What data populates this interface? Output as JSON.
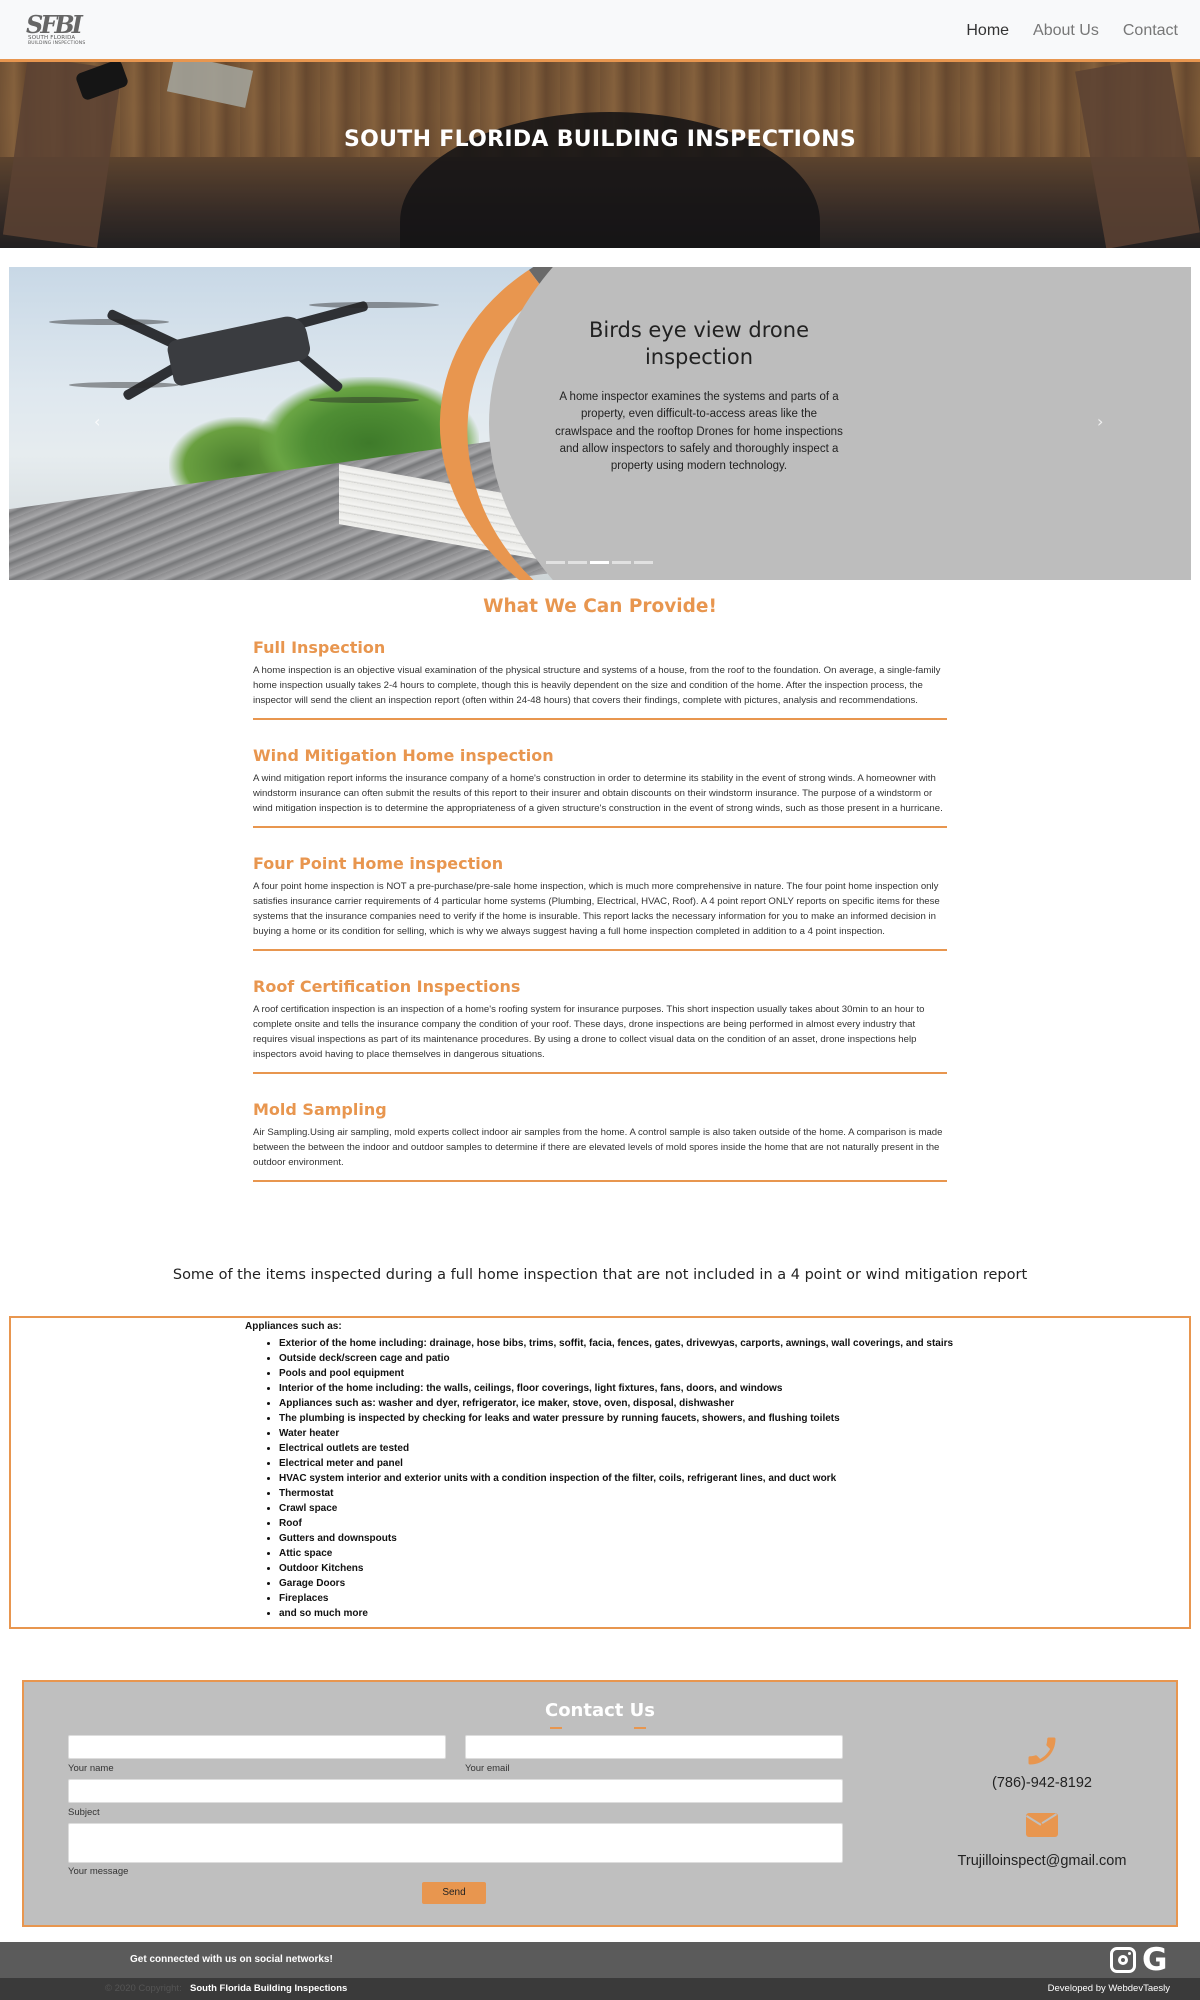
{
  "brand": {
    "logo_mark": "SFBI",
    "logo_line1": "SOUTH FLORIDA",
    "logo_line2": "BUILDING INSPECTIONS"
  },
  "nav": {
    "items": [
      {
        "label": "Home",
        "active": true
      },
      {
        "label": "About Us",
        "active": false
      },
      {
        "label": "Contact",
        "active": false
      }
    ]
  },
  "hero": {
    "title": "SOUTH FLORIDA BUILDING INSPECTIONS"
  },
  "carousel": {
    "title": "Birds eye view drone inspection",
    "text": "A home inspector examines the systems and parts of a property, even difficult-to-access areas like the crawlspace and the rooftop Drones for home inspections and allow inspectors to safely and thoroughly inspect a property using modern technology.",
    "prev_icon": "‹",
    "next_icon": "›",
    "slide_count": 5,
    "active_slide": 3
  },
  "services": {
    "title": "What We Can Provide!",
    "items": [
      {
        "title": "Full Inspection",
        "text": "A home inspection is an objective visual examination of the physical structure and systems of a house, from the roof to the foundation. On average, a single-family home inspection usually takes 2-4 hours to complete, though this is heavily dependent on the size and condition of the home. After the inspection process, the inspector will send the client an inspection report (often within 24-48 hours) that covers their findings, complete with pictures, analysis and recommendations."
      },
      {
        "title": "Wind Mitigation Home inspection",
        "text": "A wind mitigation report informs the insurance company of a home's construction in order to determine its stability in the event of strong winds. A homeowner with windstorm insurance can often submit the results of this report to their insurer and obtain discounts on their windstorm insurance. The purpose of a windstorm or wind mitigation inspection is to determine the appropriateness of a given structure's construction in the event of strong winds, such as those present in a hurricane."
      },
      {
        "title": "Four Point Home inspection",
        "text": "A four point home inspection is NOT a pre-purchase/pre-sale home inspection, which is much more comprehensive in nature. The four point home inspection only satisfies insurance carrier requirements of 4 particular home systems (Plumbing, Electrical, HVAC, Roof). A 4 point report ONLY reports on specific items for these systems that the insurance companies need to verify if the home is insurable. This report lacks the necessary information for you to make an informed decision in buying a home or its condition for selling, which is why we always suggest having a full home inspection completed in addition to a 4 point inspection."
      },
      {
        "title": "Roof Certification Inspections",
        "text": "A roof certification inspection is an inspection of a home's roofing system for insurance purposes. This short inspection usually takes about 30min to an hour to complete onsite and tells the insurance company the condition of your roof. These days, drone inspections are being performed in almost every industry that requires visual inspections as part of its maintenance procedures. By using a drone to collect visual data on the condition of an asset, drone inspections help inspectors avoid having to place themselves in dangerous situations."
      },
      {
        "title": "Mold Sampling",
        "text": "Air Sampling.Using air sampling, mold experts collect indoor air samples from the home. A control sample is also taken outside of the home. A comparison is made between the between the indoor and outdoor samples to determine if there are elevated levels of mold spores inside the home that are not naturally present in the outdoor environment."
      }
    ]
  },
  "inspected": {
    "heading": "Some of the items inspected during a full home inspection that are not included in a 4 point or wind mitigation report",
    "label": "Appliances such as:",
    "items": [
      "Exterior of the home including: drainage, hose bibs, trims, soffit, facia, fences, gates, drivewyas, carports, awnings, wall coverings, and stairs",
      "Outside deck/screen cage and patio",
      "Pools and pool equipment",
      "Interior of the home including: the walls, ceilings, floor coverings, light fixtures, fans, doors, and windows",
      "Appliances such as: washer and dyer, refrigerator, ice maker, stove, oven, disposal, dishwasher",
      "The plumbing is inspected by checking for leaks and water pressure by running faucets, showers, and flushing toilets",
      "Water heater",
      "Electrical outlets are tested",
      "Electrical meter and panel",
      "HVAC system interior and exterior units with a condition inspection of the filter, coils, refrigerant lines, and duct work",
      "Thermostat",
      "Crawl space",
      "Roof",
      "Gutters and downspouts",
      "Attic space",
      "Outdoor Kitchens",
      "Garage Doors",
      "Fireplaces",
      "and so much more"
    ]
  },
  "contact": {
    "title": "Contact Us",
    "name_label": "Your name",
    "email_label": "Your email",
    "subject_label": "Subject",
    "message_label": "Your message",
    "send_label": "Send",
    "phone": "(786)-942-8192",
    "email": "Trujilloinspect@gmail.com"
  },
  "footer": {
    "social_text": "Get connected with us on social networks!",
    "copyright_prefix": "© 2020 Copyright:",
    "copyright_name": "South Florida Building Inspections",
    "developer": "Developed by WebdevTaesly",
    "google_glyph": "G"
  },
  "colors": {
    "accent": "#e8964f",
    "panel": "#bfbfbf",
    "footer": "#5b5b5b"
  }
}
